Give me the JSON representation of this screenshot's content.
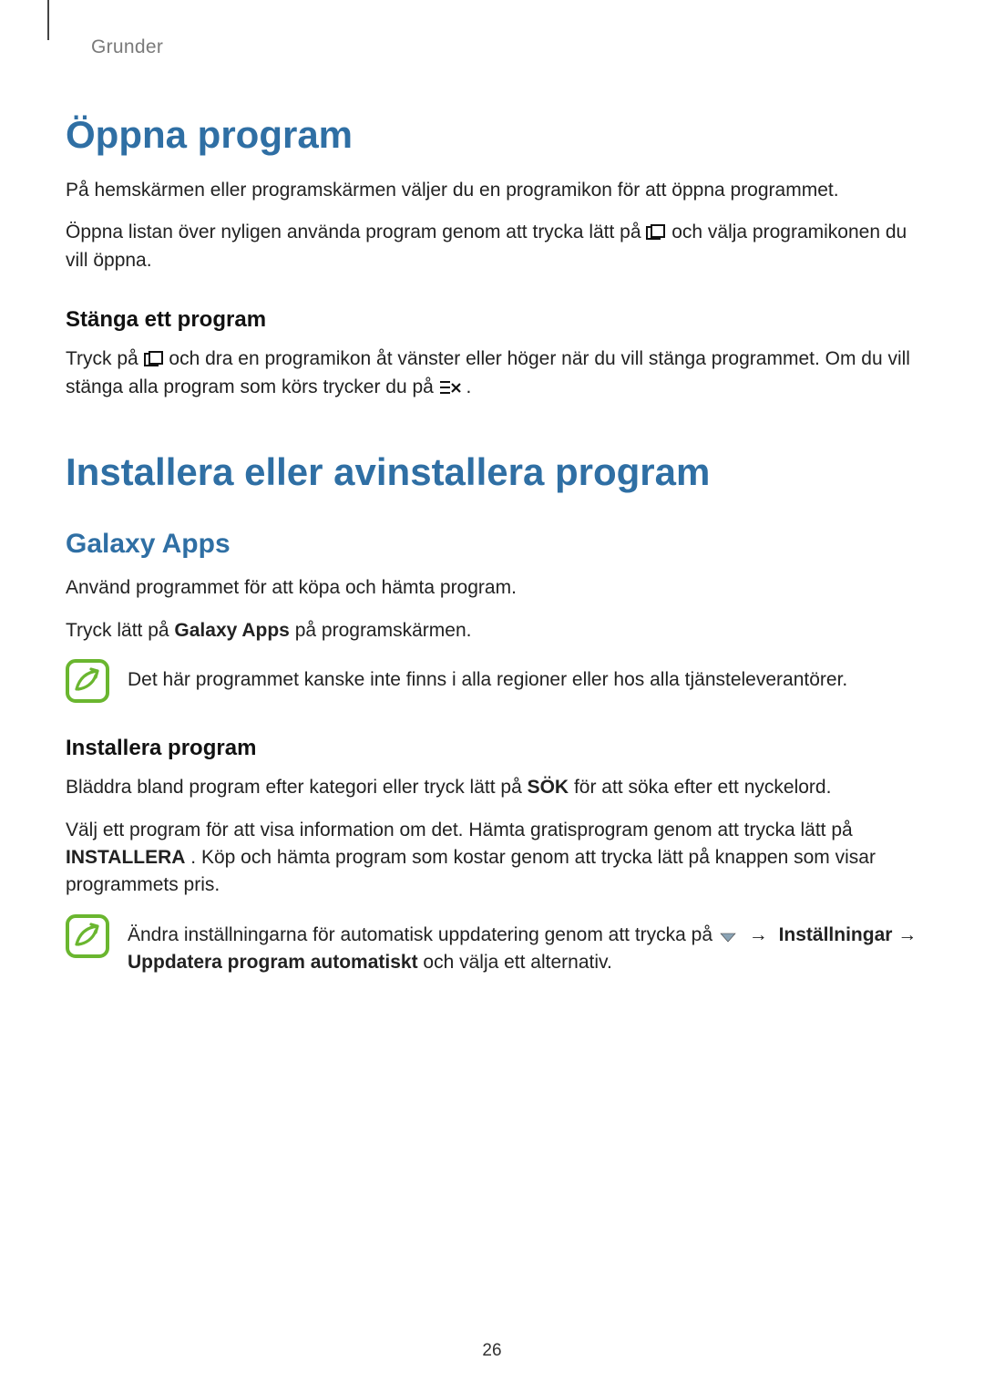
{
  "breadcrumb": "Grunder",
  "section1": {
    "title": "Öppna program",
    "p1": "På hemskärmen eller programskärmen väljer du en programikon för att öppna programmet.",
    "p2a": "Öppna listan över nyligen använda program genom att trycka lätt på ",
    "p2b": " och välja programikonen du vill öppna.",
    "sub_title": "Stänga ett program",
    "sub_p_a": "Tryck på ",
    "sub_p_b": " och dra en programikon åt vänster eller höger när du vill stänga programmet. Om du vill stänga alla program som körs trycker du på ",
    "sub_p_c": "."
  },
  "section2": {
    "title": "Installera eller avinstallera program",
    "brand": "Galaxy Apps",
    "p1": "Använd programmet för att köpa och hämta program.",
    "p2a": "Tryck lätt på ",
    "p2_bold": "Galaxy Apps",
    "p2b": " på programskärmen.",
    "note1": "Det här programmet kanske inte finns i alla regioner eller hos alla tjänsteleverantörer.",
    "install_title": "Installera program",
    "install_p1a": "Bläddra bland program efter kategori eller tryck lätt på ",
    "install_p1_bold": "SÖK",
    "install_p1b": " för att söka efter ett nyckelord.",
    "install_p2a": "Välj ett program för att visa information om det. Hämta gratisprogram genom att trycka lätt på ",
    "install_p2_bold": "INSTALLERA",
    "install_p2b": ". Köp och hämta program som kostar genom att trycka lätt på knappen som visar programmets pris.",
    "note2a": "Ändra inställningarna för automatisk uppdatering genom att trycka på ",
    "note2_arrow": "→",
    "note2_bold1": "Inställningar",
    "note2_mid": " → ",
    "note2_bold2": "Uppdatera program automatiskt",
    "note2b": " och välja ett alternativ."
  },
  "page_number": "26"
}
